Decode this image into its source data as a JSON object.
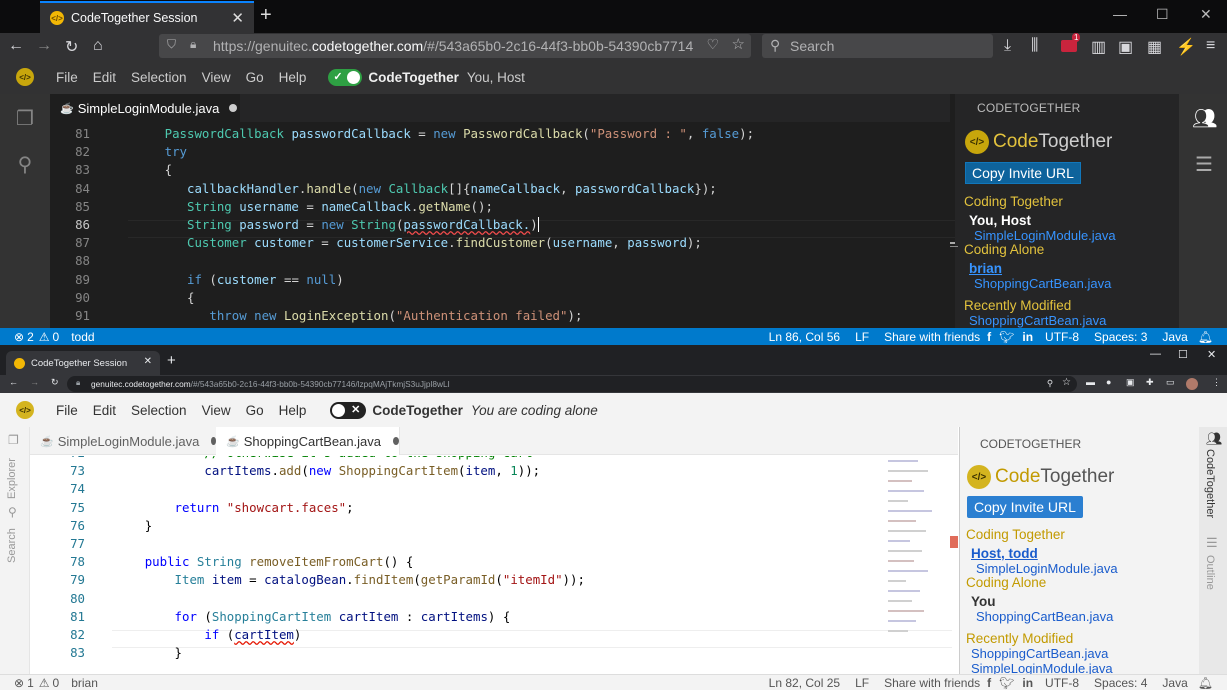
{
  "top": {
    "browser_tab": "CodeTogether Session",
    "url_prefix": "https://genuitec.",
    "url_domain": "codetogether.com",
    "url_rest": "/#/543a65b0-2c16-44f3-bb0b-54390cb7714",
    "search_placeholder": "Search",
    "badge": "1",
    "menu": [
      "File",
      "Edit",
      "Selection",
      "View",
      "Go",
      "Help"
    ],
    "toggle_label": "CodeTogether",
    "toggle_status": "You, Host",
    "editor_tab": "SimpleLoginModule.java",
    "side_header": "CODETOGETHER",
    "logo_a": "Code",
    "logo_b": "Together",
    "copy_button": "Copy Invite URL",
    "coding_together": "Coding Together",
    "ct_user": "You, Host",
    "ct_file": "SimpleLoginModule.java",
    "coding_alone": "Coding Alone",
    "ca_user": "brian",
    "ca_file": "ShoppingCartBean.java",
    "recently_modified": "Recently Modified",
    "rm_file": "ShoppingCartBean.java",
    "status": {
      "errors": "2",
      "warnings": "0",
      "user": "todd",
      "position": "Ln 86, Col 56",
      "eol": "LF",
      "share": "Share with friends",
      "encoding": "UTF-8",
      "spaces": "Spaces: 3",
      "language": "Java"
    }
  },
  "bottom": {
    "browser_tab": "CodeTogether Session",
    "url_domain": "genuitec.codetogether.com",
    "url_rest": "/#/543a65b0-2c16-44f3-bb0b-54390cb77146/lzpqMAjTkmjS3uJjpl8wLI",
    "menu": [
      "File",
      "Edit",
      "Selection",
      "View",
      "Go",
      "Help"
    ],
    "toggle_label": "CodeTogether",
    "toggle_status": "You are coding alone",
    "tab1": "SimpleLoginModule.java",
    "tab2": "ShoppingCartBean.java",
    "act_explorer": "Explorer",
    "act_search": "Search",
    "side_header": "CODETOGETHER",
    "logo_a": "Code",
    "logo_b": "Together",
    "copy_button": "Copy Invite URL",
    "coding_together": "Coding Together",
    "ct_user": "Host, todd",
    "ct_file": "SimpleLoginModule.java",
    "coding_alone": "Coding Alone",
    "ca_user": "You",
    "ca_file": "ShoppingCartBean.java",
    "recently_modified": "Recently Modified",
    "rm_file1": "ShoppingCartBean.java",
    "rm_file2": "SimpleLoginModule.java",
    "right_ct": "CodeTogether",
    "right_outline": "Outline",
    "status": {
      "errors": "1",
      "warnings": "0",
      "user": "brian",
      "position": "Ln 82, Col 25",
      "eol": "LF",
      "share": "Share with friends",
      "encoding": "UTF-8",
      "spaces": "Spaces: 4",
      "language": "Java"
    }
  }
}
